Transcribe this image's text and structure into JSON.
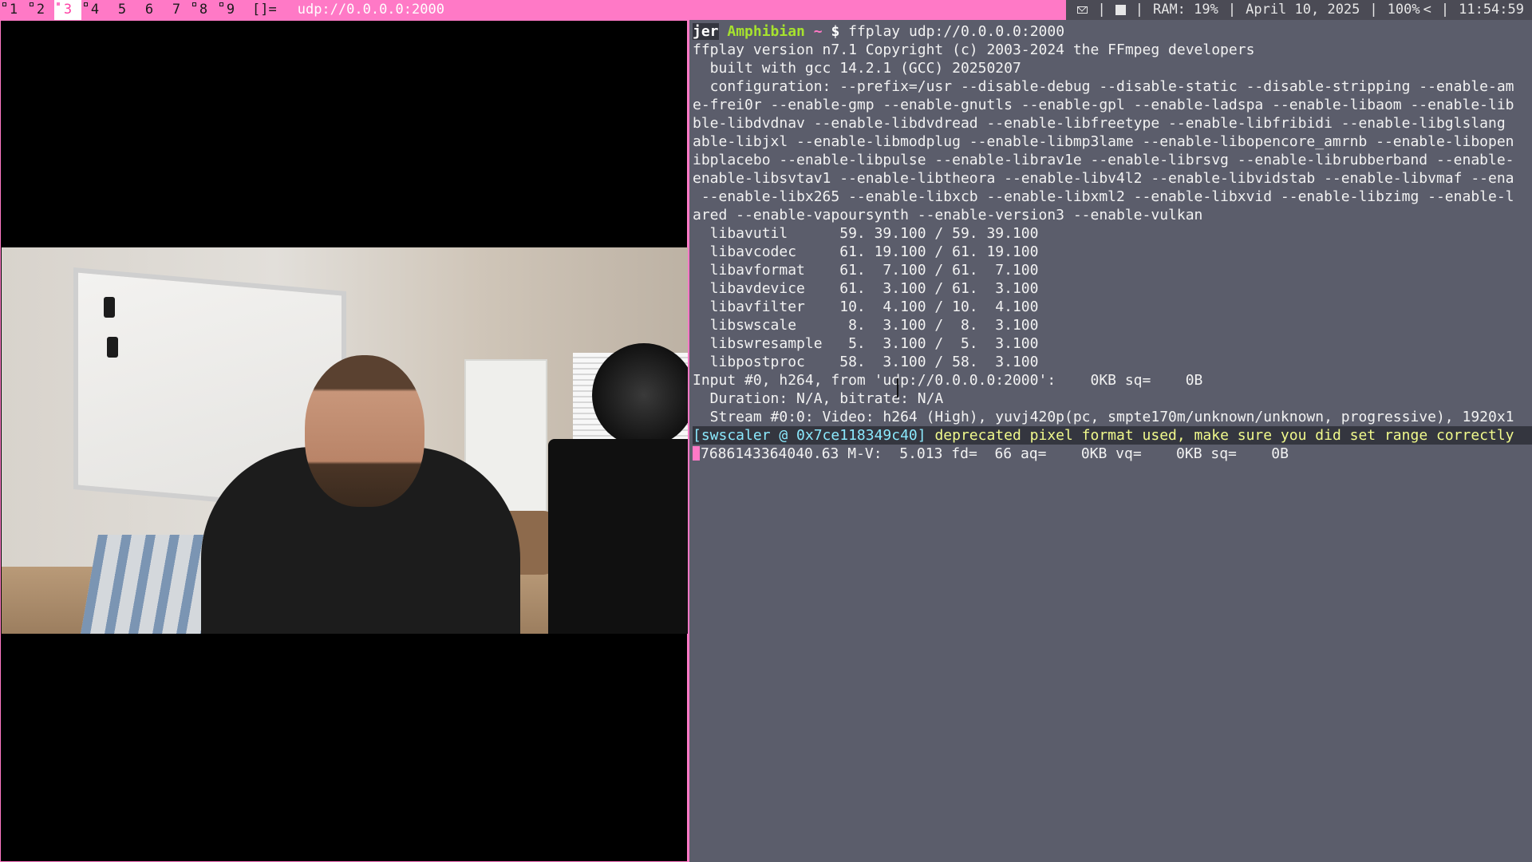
{
  "statusbar": {
    "tags": [
      "1",
      "2",
      "3",
      "4",
      "5",
      "6",
      "7",
      "8",
      "9"
    ],
    "selected_tag": "3",
    "layout_symbol": "[]=",
    "window_title": "udp://0.0.0.0:2000",
    "ram": "RAM: 19%",
    "date": "April 10, 2025",
    "volume": "100%",
    "time": "11:54:59",
    "icons": [
      "mail-icon",
      "stop-icon",
      "chevron-left-icon"
    ],
    "colors": {
      "bar": "#ff79c6",
      "status_bg": "#4b4b55"
    }
  },
  "video_window": {
    "content": "webcam stream of udp://0.0.0.0:2000"
  },
  "terminal": {
    "prompt": {
      "user": "jer",
      "host": "Amphibian",
      "dir": "~",
      "symbol": "$",
      "command": "ffplay udp://0.0.0.0:2000"
    },
    "lines": [
      "ffplay version n7.1 Copyright (c) 2003-2024 the FFmpeg developers",
      "  built with gcc 14.2.1 (GCC) 20250207",
      "  configuration: --prefix=/usr --disable-debug --disable-static --disable-stripping --enable-am",
      "e-frei0r --enable-gmp --enable-gnutls --enable-gpl --enable-ladspa --enable-libaom --enable-lib",
      "ble-libdvdnav --enable-libdvdread --enable-libfreetype --enable-libfribidi --enable-libglslang",
      "able-libjxl --enable-libmodplug --enable-libmp3lame --enable-libopencore_amrnb --enable-libopen",
      "ibplacebo --enable-libpulse --enable-librav1e --enable-librsvg --enable-librubberband --enable-",
      "enable-libsvtav1 --enable-libtheora --enable-libv4l2 --enable-libvidstab --enable-libvmaf --ena",
      " --enable-libx265 --enable-libxcb --enable-libxml2 --enable-libxvid --enable-libzimg --enable-l",
      "ared --enable-vapoursynth --enable-version3 --enable-vulkan",
      "  libavutil      59. 39.100 / 59. 39.100",
      "  libavcodec     61. 19.100 / 61. 19.100",
      "  libavformat    61.  7.100 / 61.  7.100",
      "  libavdevice    61.  3.100 / 61.  3.100",
      "  libavfilter    10.  4.100 / 10.  4.100",
      "  libswscale      8.  3.100 /  8.  3.100",
      "  libswresample   5.  3.100 /  5.  3.100",
      "  libpostproc    58.  3.100 / 58.  3.100",
      "Input #0, h264, from 'udp://0.0.0.0:2000':    0KB sq=    0B",
      "  Duration: N/A, bitrate: N/A",
      "  Stream #0:0: Video: h264 (High), yuvj420p(pc, smpte170m/unknown/unknown, progressive), 1920x1"
    ],
    "warning": {
      "tag": "[swscaler @ 0x7ce118349c40]",
      "message": " deprecated pixel format used, make sure you did set range correctly"
    },
    "progress_line": "7686143364040.63 M-V:  5.013 fd=  66 aq=    0KB vq=    0KB sq=    0B"
  }
}
